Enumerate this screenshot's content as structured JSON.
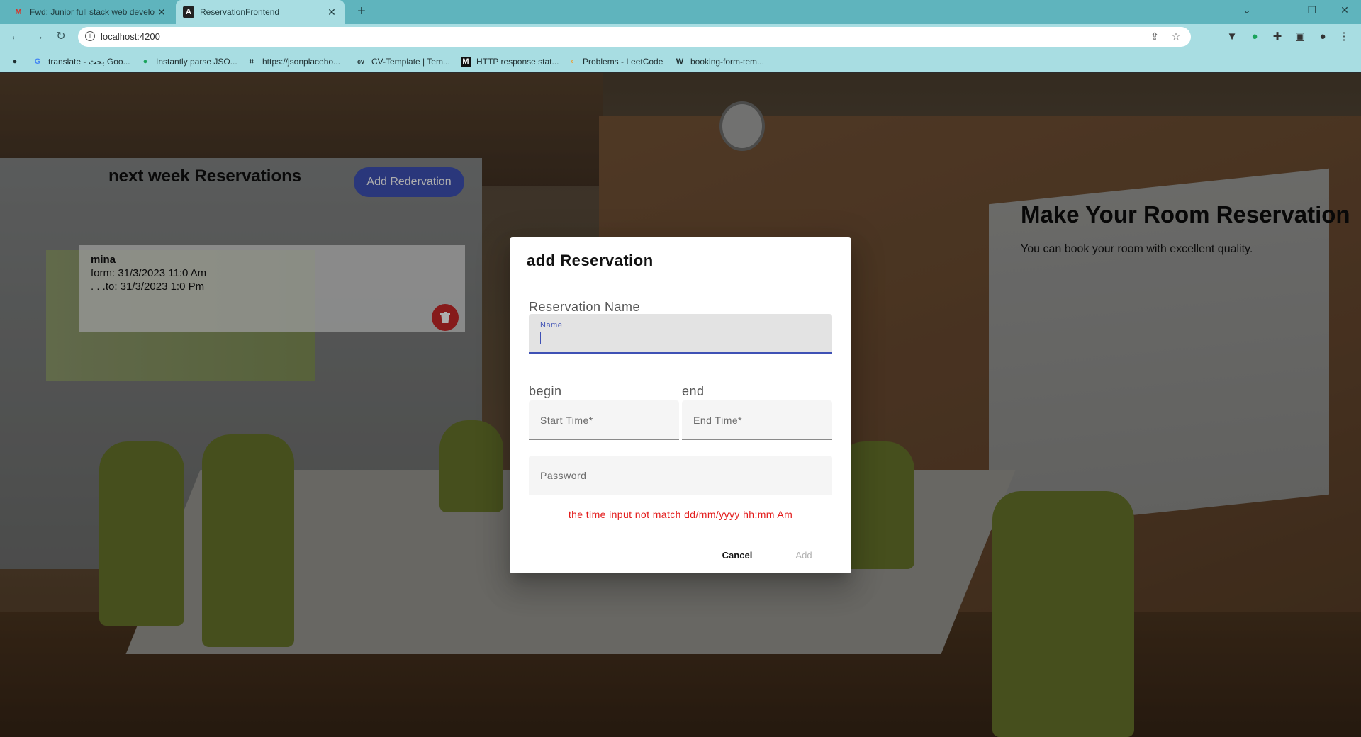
{
  "browser": {
    "tabs": [
      {
        "title": "Fwd: Junior full stack web develo",
        "favicon": "gmail-icon",
        "active": false
      },
      {
        "title": "ReservationFrontend",
        "favicon": "angular-icon",
        "active": true
      }
    ],
    "url": "localhost:4200",
    "bookmarks": [
      "translate - بحث Goo...",
      "Instantly parse JSO...",
      "https://jsonplaceho...",
      "CV-Template | Tem...",
      "HTTP response stat...",
      "Problems - LeetCode",
      "booking-form-tem..."
    ]
  },
  "page": {
    "left_title": "next week Reservations",
    "add_button": "Add Redervation",
    "reservations": [
      {
        "name": "mina",
        "from": "form: 31/3/2023 11:0 Am",
        "to": ". . .to: 31/3/2023 1:0 Pm"
      }
    ],
    "right_title": "Make Your Room Reservation",
    "right_subtitle": "You can book your room with excellent quality."
  },
  "dialog": {
    "title": "add Reservation",
    "name_section_label": "Reservation Name",
    "name_field_label": "Name",
    "name_value": "",
    "begin_label": "begin",
    "end_label": "end",
    "start_placeholder": "Start Time*",
    "end_placeholder": "End Time*",
    "password_placeholder": "Password",
    "error_text": "the time input not match dd/mm/yyyy hh:mm Am",
    "cancel_label": "Cancel",
    "add_label": "Add"
  },
  "colors": {
    "accent": "#3f51b5",
    "delete": "#c62828",
    "error": "#e31b1b",
    "tabstrip": "#5fb4bd",
    "toolbar": "#a8dde2"
  }
}
